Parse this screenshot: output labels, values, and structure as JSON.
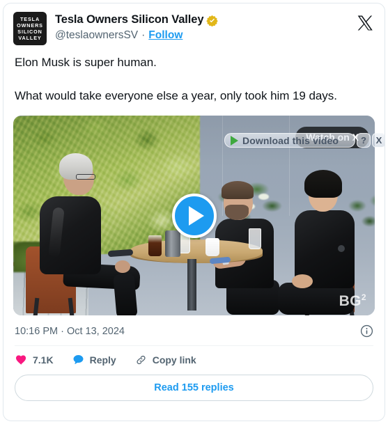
{
  "card": {
    "accent_blue": "#1d9bf0",
    "heart_pink": "#f91880",
    "verified_gold": "#e2b719"
  },
  "header": {
    "avatar_lines": [
      "TESLA",
      "OWNERS",
      "SILICON",
      "VALLEY"
    ],
    "display_name": "Tesla Owners Silicon Valley",
    "verified_icon": "verified-badge-gold",
    "handle": "@teslaownersSV",
    "separator": "·",
    "follow_label": "Follow",
    "brand_icon": "x-logo-icon"
  },
  "tweet": {
    "paragraphs": [
      "Elon Musk is super human.",
      "What would take everyone else a year, only took him 19 days."
    ]
  },
  "media": {
    "type": "video",
    "play_icon": "play-button-icon",
    "watermark": "BG",
    "watermark_sup": "2",
    "watch_on_x_label": "Watch on X",
    "overlay_widget": {
      "play_icon": "green-play-icon",
      "label": "Download this video",
      "help_label": "?",
      "close_label": "X"
    }
  },
  "meta": {
    "timestamp": "10:16 PM · Oct 13, 2024",
    "info_icon": "info-circle-icon"
  },
  "actions": [
    {
      "icon": "heart-icon",
      "label": "7.1K",
      "name": "like-action"
    },
    {
      "icon": "reply-bubble-icon",
      "label": "Reply",
      "name": "reply-action"
    },
    {
      "icon": "link-icon",
      "label": "Copy link",
      "name": "copy-link-action"
    }
  ],
  "footer": {
    "read_replies_label": "Read 155 replies"
  }
}
